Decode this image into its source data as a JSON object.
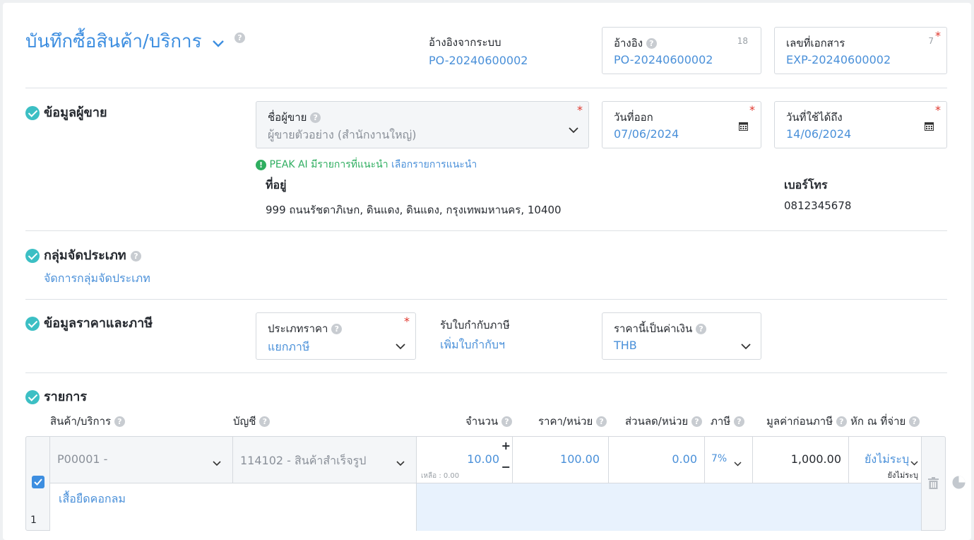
{
  "header": {
    "title": "บันทึกซื้อสินค้า/บริการ",
    "ref_system_label": "อ้างอิงจากระบบ",
    "ref_system_value": "PO-20240600002",
    "reference_label": "อ้างอิง",
    "reference_count": "18",
    "reference_value": "PO-20240600002",
    "doc_number_label": "เลขที่เอกสาร",
    "doc_number_count": "7",
    "doc_number_value": "EXP-20240600002"
  },
  "vendor": {
    "section_title": "ข้อมูลผู้ขาย",
    "name_label": "ชื่อผู้ขาย",
    "name_value": "ผู้ขายตัวอย่าง (สำนักงานใหญ่)",
    "issue_date_label": "วันที่ออก",
    "issue_date_value": "07/06/2024",
    "valid_until_label": "วันที่ใช้ได้ถึง",
    "valid_until_value": "14/06/2024",
    "ai_notice": "PEAK AI มีรายการที่แนะนำ",
    "ai_link": "เลือกรายการแนะนำ",
    "address_label": "ที่อยู่",
    "address_value": "999 ถนนรัชดาภิเษก, ดินแดง, ดินแดง, กรุงเทพมหานคร, 10400",
    "phone_label": "เบอร์โทร",
    "phone_value": "0812345678"
  },
  "category": {
    "section_title": "กลุ่มจัดประเภท",
    "manage_link": "จัดการกลุ่มจัดประเภท"
  },
  "pricing": {
    "section_title": "ข้อมูลราคาและภาษี",
    "price_type_label": "ประเภทราคา",
    "price_type_value": "แยกภาษี",
    "tax_invoice_label": "รับใบกำกับภาษี",
    "tax_invoice_link": "เพิ่มใบกำกับฯ",
    "currency_label": "ราคานี้เป็นค่าเงิน",
    "currency_value": "THB"
  },
  "items": {
    "section_title": "รายการ",
    "columns": {
      "product": "สินค้า/บริการ",
      "account": "บัญชี",
      "quantity": "จำนวน",
      "unit_price": "ราคา/หน่วย",
      "discount": "ส่วนลด/หน่วย",
      "tax": "ภาษี",
      "pre_tax": "มูลค่าก่อนภาษี",
      "withholding": "หัก ณ ที่จ่าย"
    },
    "rows": [
      {
        "index": "1",
        "product": "P00001 -",
        "account": "114102 - สินค้าสำเร็จรูป",
        "quantity": "10.00",
        "remaining": "เหลือ : 0.00",
        "unit_price": "100.00",
        "discount": "0.00",
        "tax": "7%",
        "pre_tax": "1,000.00",
        "withholding": "ยังไม่ระบุ",
        "withholding_sub": "ยังไม่ระบุ",
        "description": "เสื้อยืดคอกลม"
      }
    ]
  },
  "colors": {
    "accent": "#4a90d9",
    "check": "#3cbfc4",
    "required": "#e0362c",
    "ai_green": "#2fae60"
  }
}
